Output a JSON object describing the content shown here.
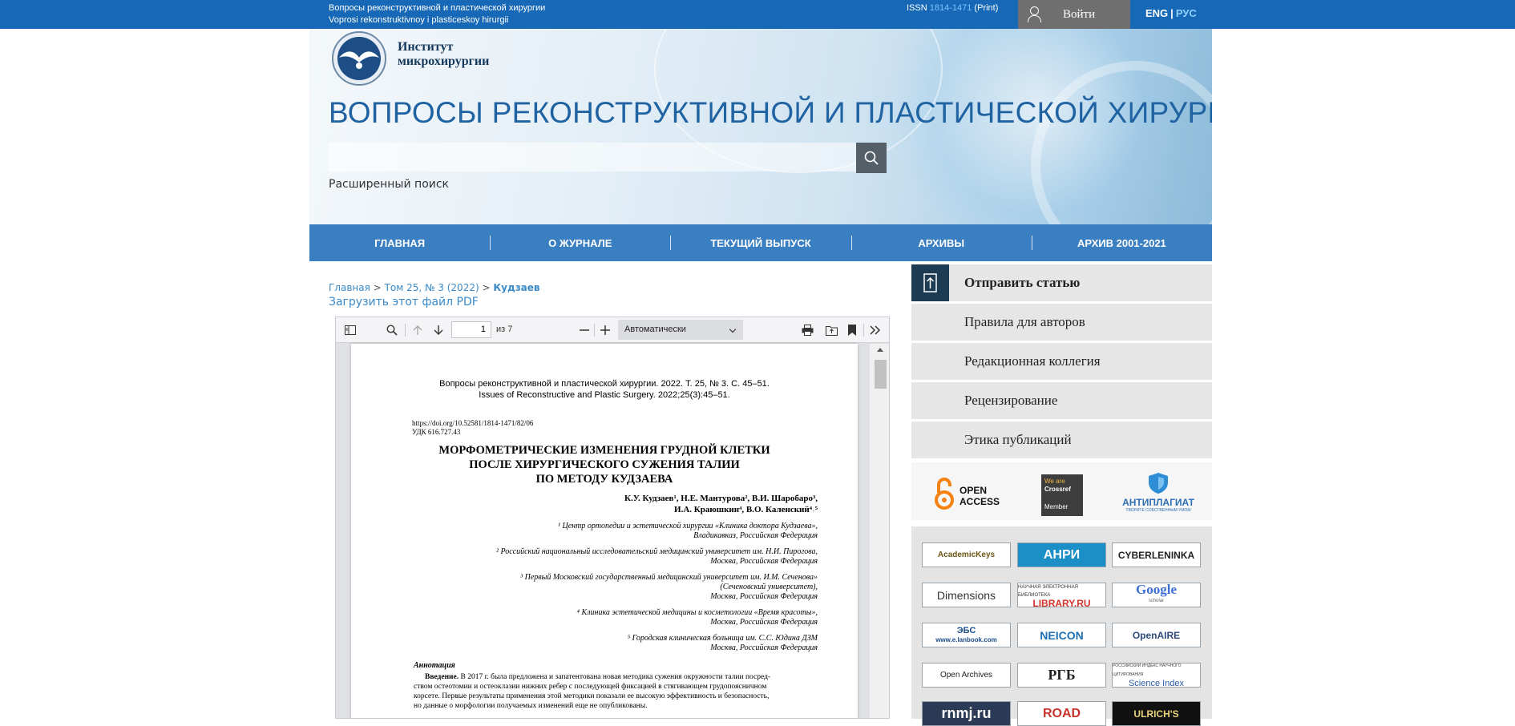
{
  "topbar": {
    "title_ru": "Вопросы реконструктивной и пластической хирургии",
    "title_lat": "Voprosi rekonstruktivnoy i plasticeskoy hirurgii",
    "issn_label": "ISSN",
    "issn_number": "1814-1471",
    "issn_type": "(Print)",
    "login_label": "Войти",
    "lang_eng": "ENG",
    "lang_sep": "|",
    "lang_rus": "РУС"
  },
  "header": {
    "logo_text_line1": "Институт",
    "logo_text_line2": "микрохирургии",
    "journal_title": "ВОПРОСЫ РЕКОНСТРУКТИВНОЙ И ПЛАСТИЧЕСКОЙ ХИРУРГИИ",
    "search_value": "",
    "advanced_search": "Расширенный поиск"
  },
  "nav": [
    {
      "label": "ГЛАВНАЯ"
    },
    {
      "label": "О ЖУРНАЛЕ"
    },
    {
      "label": "ТЕКУЩИЙ ВЫПУСК"
    },
    {
      "label": "АРХИВЫ"
    },
    {
      "label": "АРХИВ 2001-2021"
    }
  ],
  "breadcrumb": {
    "home": "Главная",
    "sep": ">",
    "issue": "Том 25, № 3 (2022)",
    "current": "Кудзаев"
  },
  "download_pdf": "Загрузить этот файл PDF",
  "viewer": {
    "page_value": "1",
    "of_pages": "из 7",
    "zoom": "Автоматически"
  },
  "pdf_page": {
    "header_line1": "Вопросы реконструктивной и пластической хирургии. 2022. Т. 25, № 3. С. 45–51.",
    "header_line2": "Issues of Reconstructive and Plastic Surgery. 2022;25(3):45–51.",
    "doi": "https://doi.org/10.52581/1814-1471/82/06",
    "udk": "УДК 616.727.43",
    "title_line1": "МОРФОМЕТРИЧЕСКИЕ ИЗМЕНЕНИЯ ГРУДНОЙ КЛЕТКИ",
    "title_line2": "ПОСЛЕ ХИРУРГИЧЕСКОГО СУЖЕНИЯ ТАЛИИ",
    "title_line3": "ПО МЕТОДУ КУДЗАЕВА",
    "authors_line1": "К.У. Кудзаев¹, Н.Е. Мантурова², В.И. Шаробаро³,",
    "authors_line2": "И.А. Краюшкин⁴, В.О. Каленский⁴˒⁵",
    "aff1_line1": "¹ Центр ортопедии и эстетической хирургии «Клиника доктора Кудзаева»,",
    "aff1_line2": "Владикавказ, Российская Федерация",
    "aff2_line1": "² Российский национальный исследовательский медицинский университет им. Н.И. Пирогова,",
    "aff2_line2": "Москва, Российская Федерация",
    "aff3_line1": "³ Первый Московский государственный медицинский университет им. И.М. Сеченова»",
    "aff3_line2": "(Сеченовский университет),",
    "aff3_line3": "Москва, Российская Федерация",
    "aff4_line1": "⁴ Клиника эстетической медицины и косметологии «Время красоты»,",
    "aff4_line2": "Москва, Российская Федерация",
    "aff5_line1": "⁵ Городская клиническая больница им. С.С. Юдина ДЗМ",
    "aff5_line2": "Москва, Российская Федерация",
    "annotation_heading": "Аннотация",
    "intro_label": "Введение.",
    "intro_line1": " В 2017 г. была предложена и запатентована новая методика сужения окружности талии посред-",
    "intro_line2": "ством остеотомии и остеоклазии нижних ребер с последующей фиксацией в стягивающем грудопоясничном",
    "intro_line3": "корсете. Первые результаты применения этой методики показали ее высокую эффективность и безопасность,",
    "intro_line4": "но данные о морфологии получаемых изменений еще не опубликованы."
  },
  "sidebar": {
    "items": [
      {
        "label": "Отправить статью"
      },
      {
        "label": "Правила для авторов"
      },
      {
        "label": "Редакционная коллегия"
      },
      {
        "label": "Рецензирование"
      },
      {
        "label": "Этика публикаций"
      }
    ]
  },
  "badges": {
    "open_access_1": "OPEN",
    "open_access_2": "ACCESS",
    "crossref_1": "We are",
    "crossref_2": "Crossref",
    "crossref_3": "Member",
    "antiplagiat": "АНТИПЛАГИАТ",
    "antiplagiat_sub": "ТВОРИТЕ СОБСТВЕННЫМ УМОМ"
  },
  "indexes": [
    {
      "label": "AcademicKeys"
    },
    {
      "label": "АНРИ"
    },
    {
      "label": "CYBERLENINKA"
    },
    {
      "label": "Dimensions"
    },
    {
      "label": "LIBRARY.RU",
      "sub": "НАУЧНАЯ ЭЛЕКТРОННАЯ БИБЛИОТЕКА"
    },
    {
      "label": "Google",
      "sub": "scholar"
    },
    {
      "label": "ЭБС",
      "sub": "www.e.lanbook.com"
    },
    {
      "label": "NEICON"
    },
    {
      "label": "OpenAIRE"
    },
    {
      "label": "Open Archives"
    },
    {
      "label": "РГБ"
    },
    {
      "label": "Science Index",
      "sub": "РОССИЙСКИЙ ИНДЕКС НАУЧНОГО ЦИТИРОВАНИЯ"
    },
    {
      "label": "rnmj.ru"
    },
    {
      "label": "ROAD"
    },
    {
      "label": "ULRICH'S"
    }
  ],
  "colors": {
    "topbar": "#1769b7",
    "nav": "#3a7fc1",
    "title": "#1f63a2",
    "link": "#3a8ac9",
    "sidebar_item": "#e6e6e6",
    "sidebar_icon": "#1d3b52"
  }
}
